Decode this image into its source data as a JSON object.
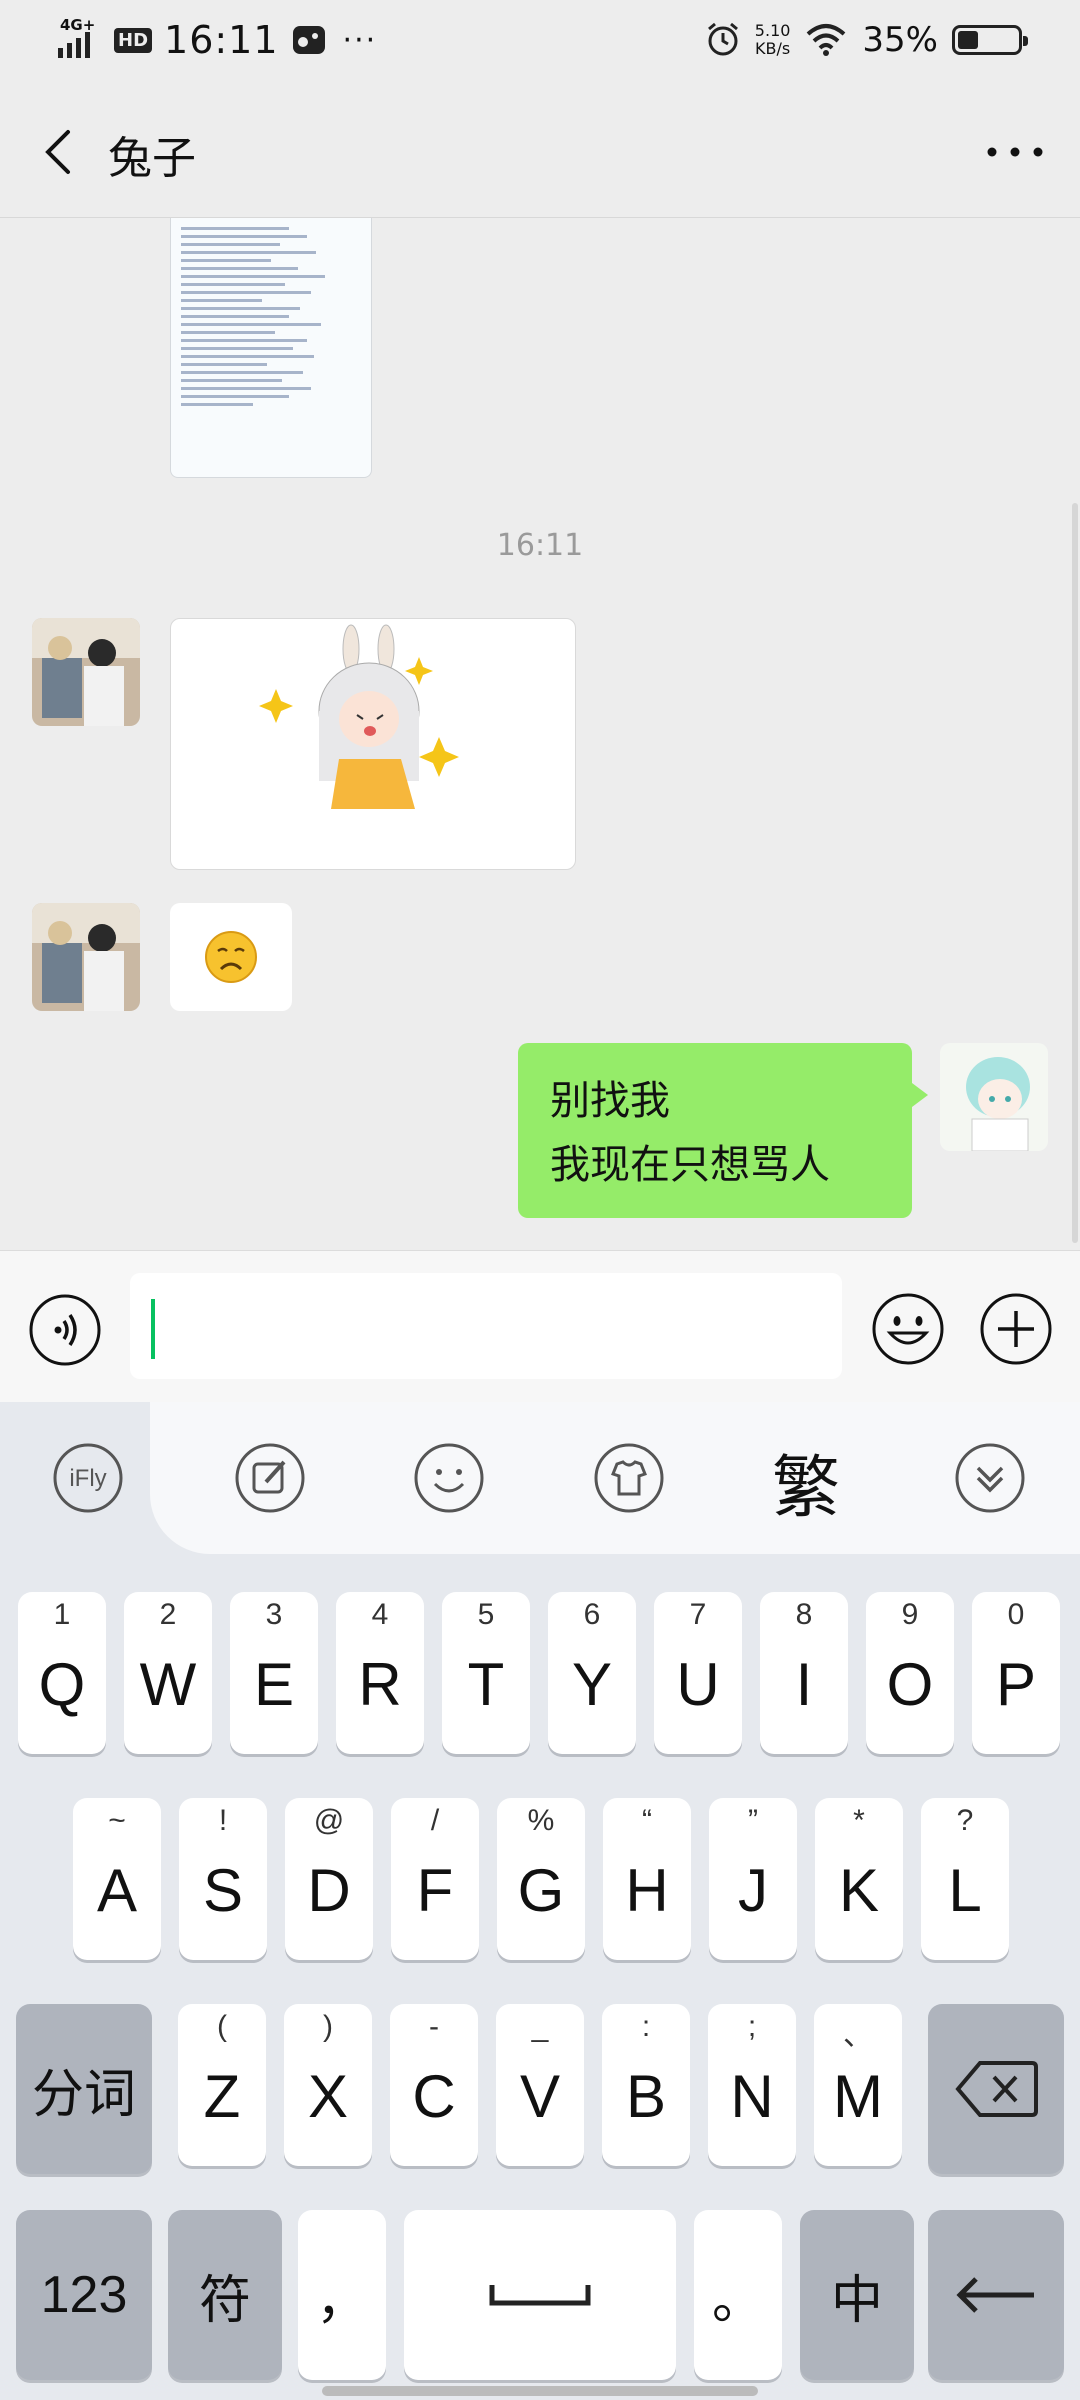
{
  "status_bar": {
    "network": "4G+",
    "hd": "HD",
    "time": "16:11",
    "overflow": "···",
    "speed_value": "5.10",
    "speed_unit": "KB/s",
    "battery_percent": "35%",
    "battery_level": 0.35,
    "icons": [
      "signal-icon",
      "game-controller-icon",
      "alarm-icon",
      "wifi-icon",
      "battery-icon"
    ]
  },
  "header": {
    "title": "兔子",
    "back_icon": "chevron-left-icon",
    "more_icon": "more-horizontal-icon"
  },
  "chat": {
    "timestamp": "16:11",
    "messages": [
      {
        "side": "left",
        "type": "sticker",
        "description": "bunny-girl-sticker"
      },
      {
        "side": "left",
        "type": "emoji",
        "emoji": "😟"
      },
      {
        "side": "right",
        "type": "text",
        "lines": [
          "别找我",
          "我现在只想骂人"
        ]
      }
    ]
  },
  "input_bar": {
    "value": "",
    "voice_icon": "voice-icon",
    "emoji_icon": "smiley-icon",
    "plus_icon": "plus-icon"
  },
  "keyboard": {
    "toolbar": {
      "ifly": "iFly",
      "traditional": "繁",
      "icons": [
        "ifly-logo-icon",
        "edit-icon",
        "emoji-icon",
        "theme-shirt-icon",
        "collapse-icon"
      ]
    },
    "row1": [
      {
        "main": "Q",
        "sub": "1"
      },
      {
        "main": "W",
        "sub": "2"
      },
      {
        "main": "E",
        "sub": "3"
      },
      {
        "main": "R",
        "sub": "4"
      },
      {
        "main": "T",
        "sub": "5"
      },
      {
        "main": "Y",
        "sub": "6"
      },
      {
        "main": "U",
        "sub": "7"
      },
      {
        "main": "I",
        "sub": "8"
      },
      {
        "main": "O",
        "sub": "9"
      },
      {
        "main": "P",
        "sub": "0"
      }
    ],
    "row2": [
      {
        "main": "A",
        "sub": "~"
      },
      {
        "main": "S",
        "sub": "!"
      },
      {
        "main": "D",
        "sub": "@"
      },
      {
        "main": "F",
        "sub": "/"
      },
      {
        "main": "G",
        "sub": "%"
      },
      {
        "main": "H",
        "sub": "“"
      },
      {
        "main": "J",
        "sub": "”"
      },
      {
        "main": "K",
        "sub": "*"
      },
      {
        "main": "L",
        "sub": "?"
      }
    ],
    "row3": [
      {
        "main": "Z",
        "sub": "("
      },
      {
        "main": "X",
        "sub": ")"
      },
      {
        "main": "C",
        "sub": "-"
      },
      {
        "main": "V",
        "sub": "_"
      },
      {
        "main": "B",
        "sub": ":"
      },
      {
        "main": "N",
        "sub": ";"
      },
      {
        "main": "M",
        "sub": "、"
      }
    ],
    "fenci": "分词",
    "num": "123",
    "symbol": "符",
    "comma": "，",
    "period": "。",
    "zhong": "中"
  }
}
